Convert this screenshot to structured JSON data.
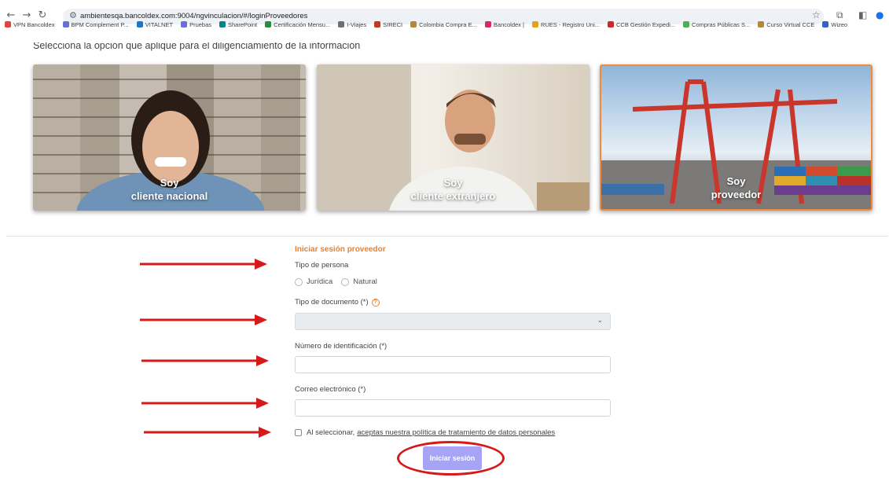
{
  "browser": {
    "url": "ambientesqa.bancoldex.com:9004/ngvinculacion/#/loginProveedores",
    "bookmarks": [
      {
        "label": "VPN Bancoldex",
        "color": "#e8403a"
      },
      {
        "label": "BPM Complement P...",
        "color": "#6c6fd6"
      },
      {
        "label": "VITALNET",
        "color": "#1e76c8"
      },
      {
        "label": "Pruebas",
        "color": "#6c6fd6"
      },
      {
        "label": "SharePoint",
        "color": "#038387"
      },
      {
        "label": "Certificación Mensu...",
        "color": "#2a8a3e"
      },
      {
        "label": "I-Viajes",
        "color": "#707070"
      },
      {
        "label": "SIRECI",
        "color": "#c8361b"
      },
      {
        "label": "Colombia Compra E...",
        "color": "#b08a3a"
      },
      {
        "label": "Bancoldex |",
        "color": "#d62b5c"
      },
      {
        "label": "RUES - Registro Uni...",
        "color": "#e2a21b"
      },
      {
        "label": "CCB Gestión Expedi...",
        "color": "#d02828"
      },
      {
        "label": "Compras Públicas S...",
        "color": "#4caf50"
      },
      {
        "label": "Curso Virtual CCE",
        "color": "#b08a3a"
      },
      {
        "label": "Wizeo",
        "color": "#2f64c8"
      }
    ]
  },
  "intro": "Selecciona la opción que aplique para el diligenciamiento de la información",
  "cards": [
    {
      "line1": "Soy",
      "line2": "cliente nacional"
    },
    {
      "line1": "Soy",
      "line2": "cliente extranjero"
    },
    {
      "line1": "Soy",
      "line2": "proveedor"
    }
  ],
  "form": {
    "title": "Iniciar sesión proveedor",
    "person_type_label": "Tipo de persona",
    "person_options": [
      "Jurídica",
      "Natural"
    ],
    "doc_type_label": "Tipo de documento (*)",
    "id_number_label": "Número de identificación (*)",
    "email_label": "Correo electrónico (*)",
    "consent_text": "Al seleccionar,",
    "consent_link": "aceptas nuestra política de tratamiento de datos personales",
    "submit_label": "Iniciar sesión"
  },
  "colors": {
    "accent": "#f07e26",
    "button": "#a7a3f5",
    "annotation": "#d61a1a"
  }
}
